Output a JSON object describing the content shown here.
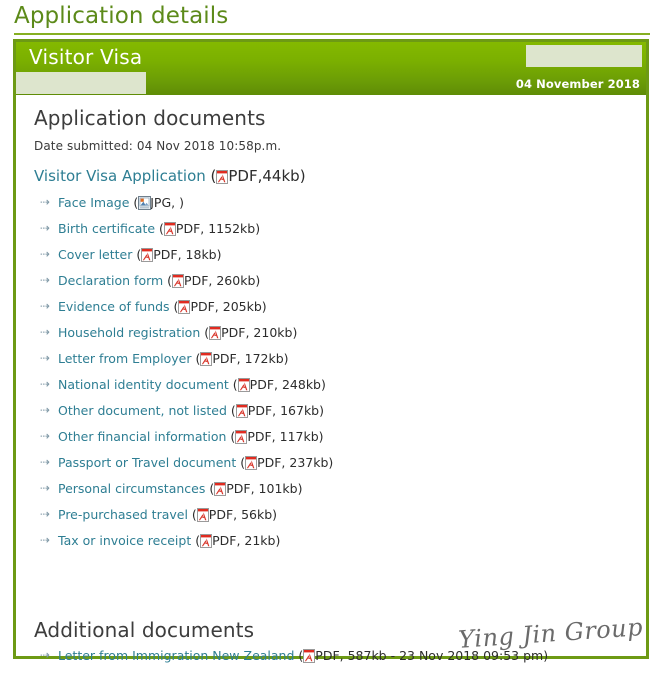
{
  "page": {
    "title": "Application details"
  },
  "header": {
    "visa_type": "Visitor Visa",
    "date": "04 November 2018",
    "redaction_color": "#dde5cd",
    "band_color_top": "#84b900",
    "band_color_bottom": "#5f8c06"
  },
  "colors": {
    "title_green": "#5c8a19",
    "border_green": "#6d9a14",
    "link_teal": "#2e7e93",
    "heading_grey": "#3d3d3d",
    "arrow_grey": "#7e97a5"
  },
  "application": {
    "section_heading": "Application documents",
    "date_submitted_label": "Date submitted:",
    "date_submitted_value": "04 Nov 2018  10:58p.m.",
    "main_document": {
      "label": "Visitor Visa Application",
      "open_paren": "(",
      "icon": "pdf-icon",
      "type": "PDF,",
      "size": "44kb",
      "close_paren": ")"
    },
    "documents": [
      {
        "label": "Face Image",
        "icon": "jpg-icon",
        "type": "JPG,",
        "size": "",
        "detail": "JPG, )"
      },
      {
        "label": "Birth certificate",
        "icon": "pdf-icon",
        "type": "PDF,",
        "size": "1152kb",
        "detail": "PDF, 1152kb)"
      },
      {
        "label": "Cover letter",
        "icon": "pdf-icon",
        "type": "PDF,",
        "size": "18kb",
        "detail": "PDF, 18kb)"
      },
      {
        "label": "Declaration form",
        "icon": "pdf-icon",
        "type": "PDF,",
        "size": "260kb",
        "detail": "PDF, 260kb)"
      },
      {
        "label": "Evidence of funds",
        "icon": "pdf-icon",
        "type": "PDF,",
        "size": "205kb",
        "detail": "PDF, 205kb)"
      },
      {
        "label": "Household registration",
        "icon": "pdf-icon",
        "type": "PDF,",
        "size": "210kb",
        "detail": "PDF, 210kb)"
      },
      {
        "label": "Letter from Employer",
        "icon": "pdf-icon",
        "type": "PDF,",
        "size": "172kb",
        "detail": "PDF, 172kb)"
      },
      {
        "label": "National identity document",
        "icon": "pdf-icon",
        "type": "PDF,",
        "size": "248kb",
        "detail": "PDF, 248kb)"
      },
      {
        "label": "Other document, not listed",
        "icon": "pdf-icon",
        "type": "PDF,",
        "size": "167kb",
        "detail": "PDF, 167kb)"
      },
      {
        "label": "Other financial information",
        "icon": "pdf-icon",
        "type": "PDF,",
        "size": "117kb",
        "detail": "PDF, 117kb)"
      },
      {
        "label": "Passport or Travel document",
        "icon": "pdf-icon",
        "type": "PDF,",
        "size": "237kb",
        "detail": "PDF, 237kb)"
      },
      {
        "label": "Personal circumstances",
        "icon": "pdf-icon",
        "type": "PDF,",
        "size": "101kb",
        "detail": "PDF, 101kb)"
      },
      {
        "label": "Pre-purchased travel",
        "icon": "pdf-icon",
        "type": "PDF,",
        "size": "56kb",
        "detail": "PDF, 56kb)"
      },
      {
        "label": "Tax or invoice receipt",
        "icon": "pdf-icon",
        "type": "PDF,",
        "size": "21kb",
        "detail": "PDF, 21kb)"
      }
    ]
  },
  "additional": {
    "section_heading": "Additional documents",
    "documents": [
      {
        "label": "Letter from Immigration New Zealand",
        "icon": "pdf-icon",
        "detail": "PDF, 587kb - 23 Nov 2018 09:53 pm)"
      }
    ]
  },
  "watermark": {
    "text": "Ying Jin Group"
  }
}
